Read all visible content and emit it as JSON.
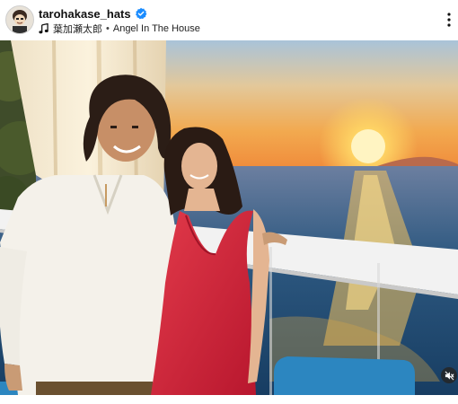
{
  "post": {
    "username": "tarohakase_hats",
    "audio": {
      "artist": "葉加瀬太郎",
      "separator": "•",
      "track": "Angel In The House"
    }
  },
  "icons": {
    "avatar": "avatar",
    "verified": "verified-badge-icon",
    "music": "music-note-icon",
    "more": "more-options-icon",
    "mute": "speaker-muted-icon"
  },
  "colors": {
    "verified_blue": "#1a8cff",
    "sky_top": "#a9c3d9",
    "sunset_glow": "#f7c45a",
    "sea": "#1c4f7a",
    "dress_red": "#d2253c"
  }
}
